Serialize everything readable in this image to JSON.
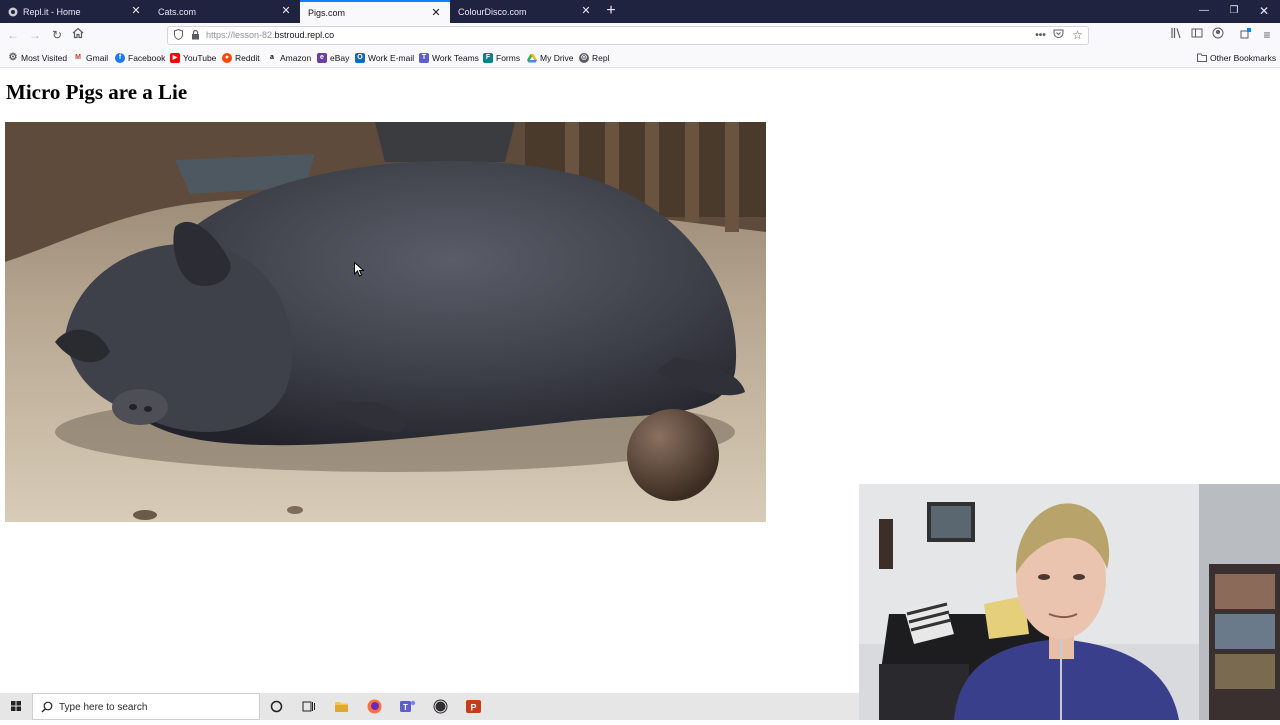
{
  "browser": {
    "tabs": [
      {
        "title": "Repl.it - Home",
        "active": false
      },
      {
        "title": "Cats.com",
        "active": false
      },
      {
        "title": "Pigs.com",
        "active": true
      },
      {
        "title": "ColourDisco.com",
        "active": false
      }
    ],
    "url": {
      "prefix": "https://lesson-82.",
      "host": "bstroud.repl.co"
    },
    "bookmarks": [
      {
        "label": "Most Visited",
        "icon": "gear-icon"
      },
      {
        "label": "Gmail",
        "icon": "gmail-icon"
      },
      {
        "label": "Facebook",
        "icon": "facebook-icon"
      },
      {
        "label": "YouTube",
        "icon": "youtube-icon"
      },
      {
        "label": "Reddit",
        "icon": "reddit-icon"
      },
      {
        "label": "Amazon",
        "icon": "amazon-icon"
      },
      {
        "label": "eBay",
        "icon": "ebay-icon"
      },
      {
        "label": "Work E-mail",
        "icon": "outlook-icon"
      },
      {
        "label": "Work Teams",
        "icon": "teams-icon"
      },
      {
        "label": "Forms",
        "icon": "forms-icon"
      },
      {
        "label": "My Drive",
        "icon": "drive-icon"
      },
      {
        "label": "Repl",
        "icon": "repl-icon"
      }
    ],
    "other_bookmarks": "Other Bookmarks"
  },
  "page": {
    "heading": "Micro Pigs are a Lie"
  },
  "taskbar": {
    "search_placeholder": "Type here to search"
  },
  "colors": {
    "tab_bar": "#202340",
    "active_tab_accent": "#0a84ff",
    "taskbar": "#e6e6e6"
  }
}
